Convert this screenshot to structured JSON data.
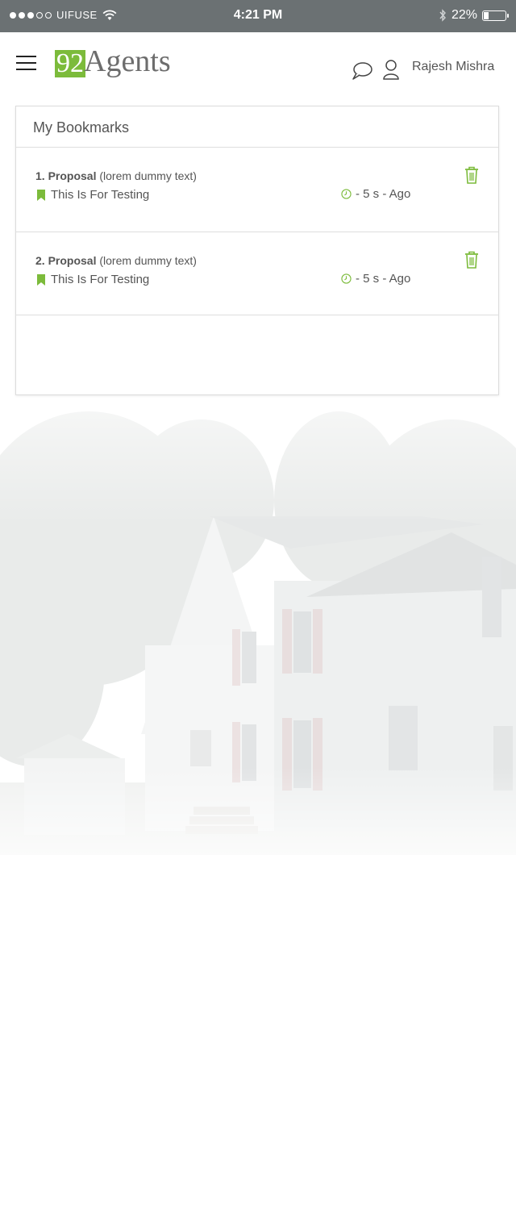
{
  "status_bar": {
    "carrier": "UIFUSE",
    "time": "4:21 PM",
    "battery": "22%"
  },
  "header": {
    "logo_number": "92",
    "logo_word": "Agents",
    "user_name": "Rajesh Mishra"
  },
  "bookmarks": {
    "title": "My Bookmarks",
    "items": [
      {
        "number": "1.",
        "title": "Proposal",
        "detail": "(lorem dummy text)",
        "subtitle": "This Is For Testing",
        "time": "- 5 s - Ago"
      },
      {
        "number": "2.",
        "title": "Proposal",
        "detail": "(lorem dummy text)",
        "subtitle": "This Is For Testing",
        "time": "- 5 s - Ago"
      }
    ]
  },
  "colors": {
    "accent": "#7cbb3b",
    "status_bar": "#6b7173"
  }
}
